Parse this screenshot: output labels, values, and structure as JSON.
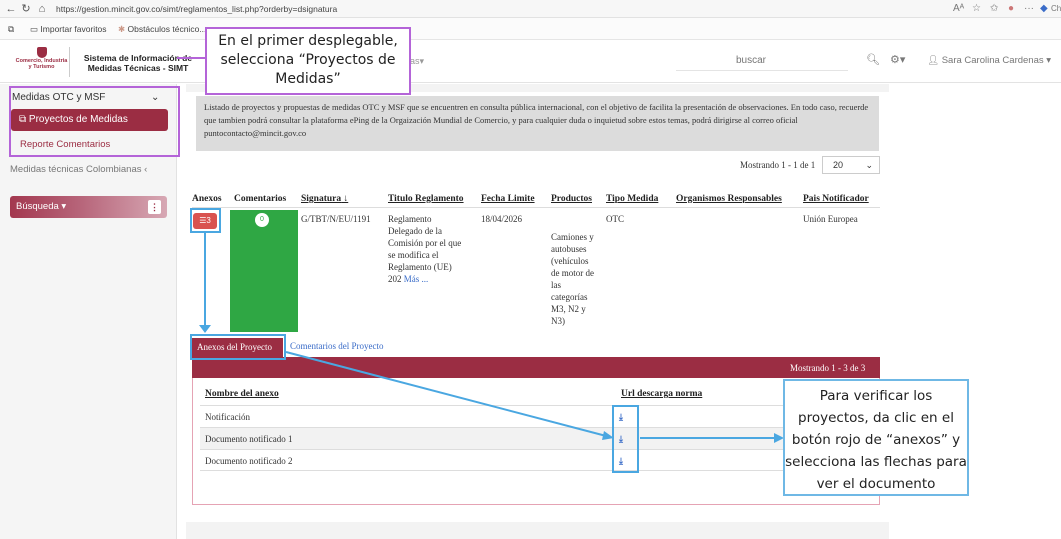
{
  "browser": {
    "url": "https://gestion.mincit.gov.co/simt/reglamentos_list.php?orderby=dsignatura",
    "favorites": [
      "Importar favoritos",
      "Obstáculos técnico..."
    ],
    "profile_short": "Ch"
  },
  "header": {
    "logo_text": "Comercio, Industria y Turismo",
    "system_title": "Sistema de Información de Medidas Técnicas - SIMT",
    "menu_fragment": "as",
    "search_placeholder": "buscar",
    "user_name": "Sara Carolina Cardenas"
  },
  "sidebar": {
    "group_label": "Medidas OTC y MSF",
    "active_item": "Proyectos de Medidas",
    "sub_item": "Reporte Comentarios",
    "collapsed_group": "Medidas técnicas Colombianas",
    "search_label": "Búsqueda"
  },
  "main": {
    "notice": "Listado de proyectos y propuestas de medidas OTC y MSF que se encuentren en consulta pública internacional, con el objetivo de facilita la presentación de observaciones. En todo caso, recuerde que tambien podrá consultar la plataforma ePing de la Orgaización Mundial de Comercio, y para cualquier duda o inquietud sobre estos temas, podrá dirigirse al correo oficial puntocontacto@mincit.gov.co",
    "showing": "Mostrando 1 - 1 de 1",
    "per_page": "20",
    "columns": {
      "anexos": "Anexos",
      "comentarios": "Comentarios",
      "signatura": "Signatura",
      "titulo": "Titulo Reglamento",
      "fecha": "Fecha Limite",
      "productos": "Productos",
      "tipo": "Tipo Medida",
      "organismos": "Organismos Responsables",
      "pais": "Pais Notificador"
    },
    "row": {
      "annex_count": "3",
      "comment_count": "0",
      "signatura": "G/TBT/N/EU/1191",
      "titulo_lines": [
        "Reglamento",
        "Delegado de la",
        "Comisión por el que",
        "se modifica el",
        "Reglamento (UE)",
        "202"
      ],
      "more_link": "Más ...",
      "fecha": "18/04/2026",
      "productos_lines": [
        "Camiones y",
        "autobuses",
        "(vehículos",
        "de motor de",
        "las",
        "categorías",
        "M3, N2 y",
        "N3)"
      ],
      "tipo": "OTC",
      "pais": "Unión Europea"
    },
    "tabs": {
      "annexes": "Anexos del Proyecto",
      "comments": "Comentarios del Proyecto"
    },
    "annex_showing": "Mostrando 1 - 3 de 3",
    "annex_columns": {
      "name": "Nombre del anexo",
      "url": "Url descarga norma"
    },
    "annexes": [
      "Notificación",
      "Documento notificado 1",
      "Documento notificado 2"
    ]
  },
  "annotations": {
    "callout1": "En el primer desplegable, selecciona “Proyectos de Medidas”",
    "callout2": "Para verificar los proyectos, da clic en el botón rojo de “anexos” y selecciona las flechas para ver el documento"
  },
  "colors": {
    "brand": "#9b2d43",
    "green": "#2fa744",
    "annex_red": "#d9534f",
    "link": "#3a6cc8",
    "callout_blue": "#4aa7e1",
    "callout_purple": "#b464d8"
  }
}
